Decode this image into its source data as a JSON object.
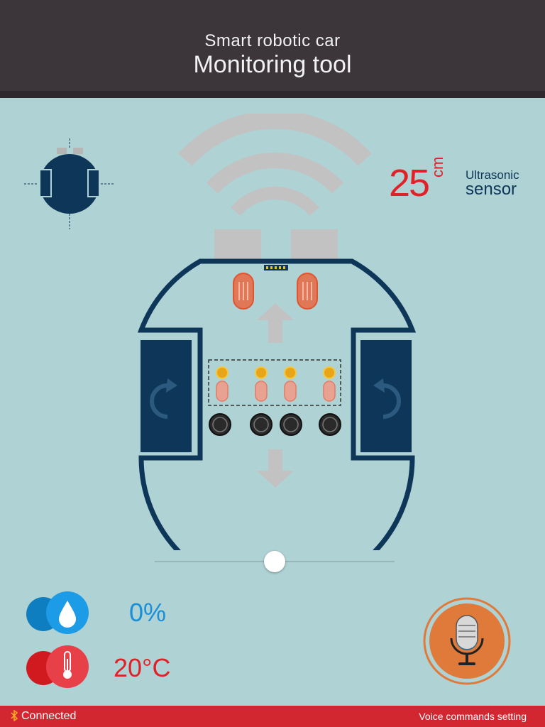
{
  "header": {
    "subtitle": "Smart robotic car",
    "title": "Monitoring tool"
  },
  "ultrasonic": {
    "value": "25",
    "unit": "cm",
    "label_line1": "Ultrasonic",
    "label_line2": "sensor"
  },
  "sensors": {
    "humidity": {
      "value": "0%",
      "icon": "water-drop-icon"
    },
    "temperature": {
      "value": "20°C",
      "icon": "thermometer-icon"
    }
  },
  "speed_slider": {
    "value_fraction": 0.5
  },
  "footer": {
    "status": "Connected",
    "voice_link": "Voice commands setting"
  },
  "colors": {
    "header_bg": "#3c3539",
    "background": "#afd2d4",
    "navy": "#0d3658",
    "red": "#e12128",
    "blue": "#1a8fd8",
    "orange": "#e07a3a",
    "footer_bg": "#d22630"
  }
}
